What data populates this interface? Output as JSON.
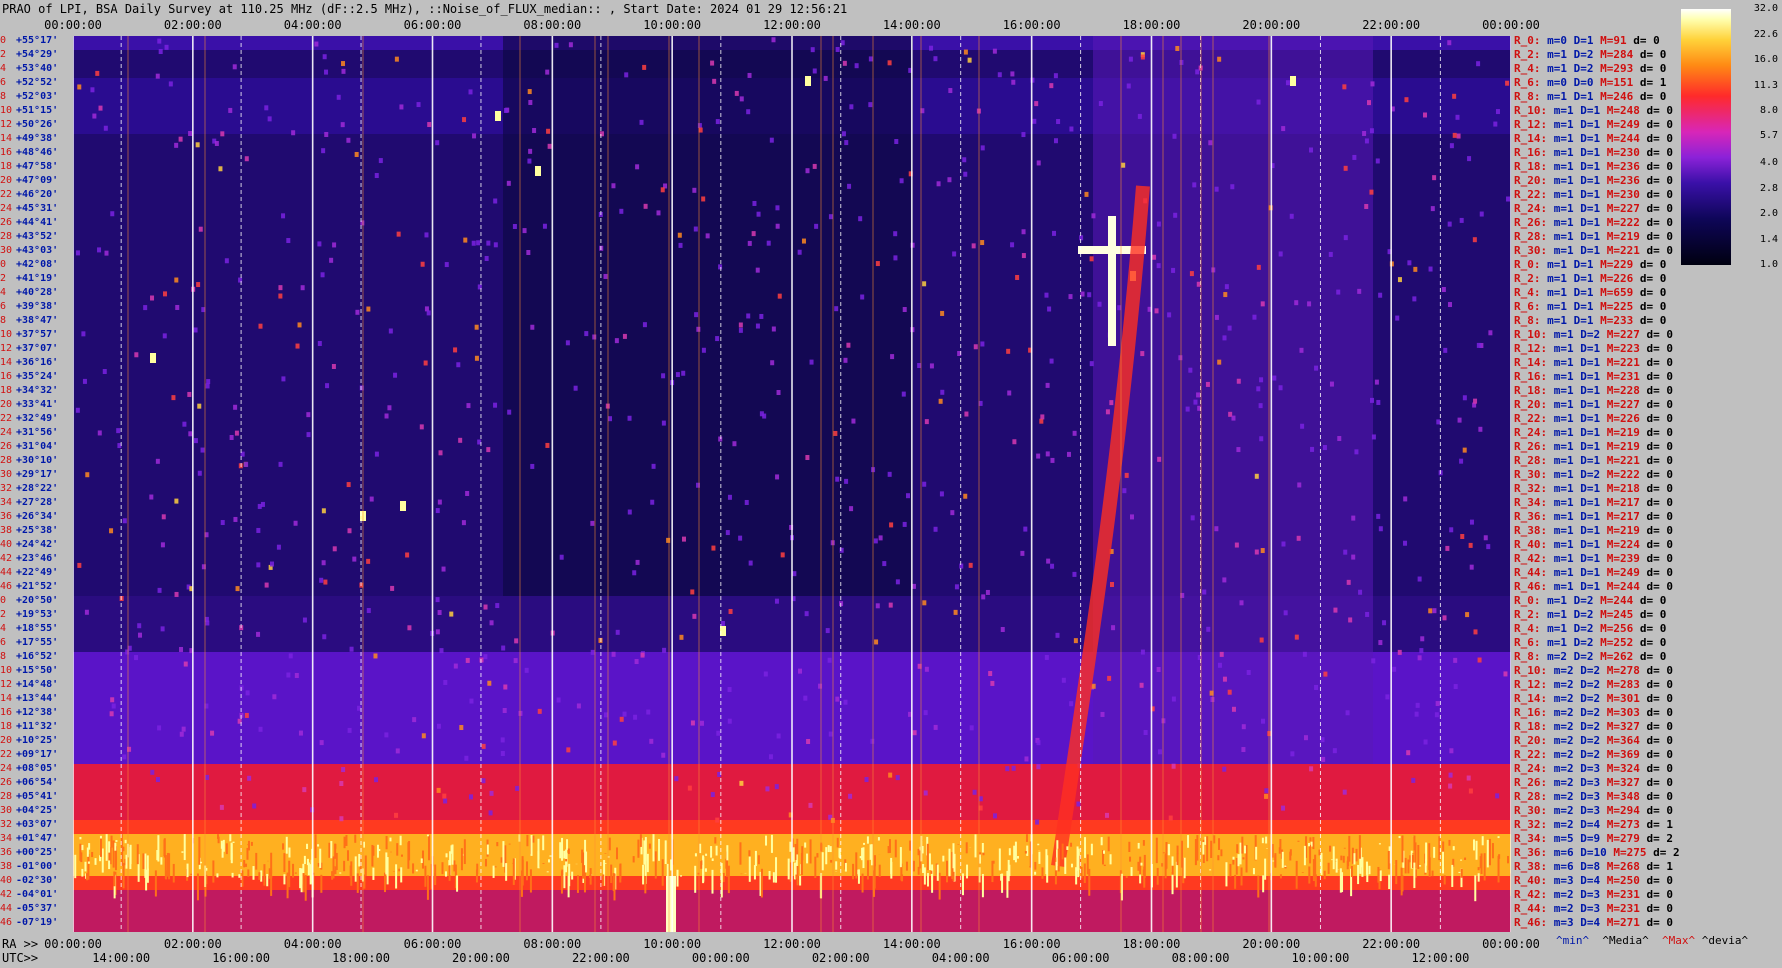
{
  "title": "PRAO of LPI, BSA Daily Survey at 110.25 MHz (dF::2.5 MHz), ::Noise_of_FLUX_median:: , Start Date: 2024 01 29 12:56:21",
  "chart_data": {
    "type": "heatmap",
    "title": "PRAO of LPI, BSA Daily Survey at 110.25 MHz (dF::2.5 MHz), ::Noise_of_FLUX_median:: , Start Date: 2024 01 29 12:56:21",
    "x_top_ticks": [
      "00:00:00",
      "02:00:00",
      "04:00:00",
      "06:00:00",
      "08:00:00",
      "10:00:00",
      "12:00:00",
      "14:00:00",
      "16:00:00",
      "18:00:00",
      "20:00:00",
      "22:00:00",
      "00:00:00"
    ],
    "ra_prefix": "RA >>",
    "ra_ticks": [
      "00:00:00",
      "02:00:00",
      "04:00:00",
      "06:00:00",
      "08:00:00",
      "10:00:00",
      "12:00:00",
      "14:00:00",
      "16:00:00",
      "18:00:00",
      "20:00:00",
      "22:00:00",
      "00:00:00"
    ],
    "utc_prefix": "UTC>>",
    "utc_ticks": [
      "14:00:00",
      "16:00:00",
      "18:00:00",
      "20:00:00",
      "22:00:00",
      "00:00:00",
      "02:00:00",
      "04:00:00",
      "06:00:00",
      "08:00:00",
      "10:00:00",
      "12:00:00"
    ],
    "dec_labels": [
      "+55°17'",
      "+54°29'",
      "+53°40'",
      "+52°52'",
      "+52°03'",
      "+51°15'",
      "+50°26'",
      "+49°38'",
      "+48°46'",
      "+47°58'",
      "+47°09'",
      "+46°20'",
      "+45°31'",
      "+44°41'",
      "+43°52'",
      "+43°03'",
      "+42°08'",
      "+41°19'",
      "+40°28'",
      "+39°38'",
      "+38°47'",
      "+37°57'",
      "+37°07'",
      "+36°16'",
      "+35°24'",
      "+34°32'",
      "+33°41'",
      "+32°49'",
      "+31°56'",
      "+31°04'",
      "+30°10'",
      "+29°17'",
      "+28°22'",
      "+27°28'",
      "+26°34'",
      "+25°38'",
      "+24°42'",
      "+23°46'",
      "+22°49'",
      "+21°52'",
      "+20°50'",
      "+19°53'",
      "+18°55'",
      "+17°55'",
      "+16°52'",
      "+15°50'",
      "+14°48'",
      "+13°44'",
      "+12°38'",
      "+11°32'",
      "+10°25'",
      "+09°17'",
      "+08°05'",
      "+06°54'",
      "+05°41'",
      "+04°25'",
      "+03°07'",
      "+01°47'",
      "+00°25'",
      "-01°00'",
      "-02°30'",
      "-04°01'",
      "-05°37'",
      "-07°19'"
    ],
    "dec_index": [
      "0",
      "2",
      "4",
      "6",
      "8",
      "10",
      "12",
      "14",
      "16",
      "18",
      "20",
      "22",
      "24",
      "26",
      "28",
      "30",
      "0",
      "2",
      "4",
      "6",
      "8",
      "10",
      "12",
      "14",
      "16",
      "18",
      "20",
      "22",
      "24",
      "26",
      "28",
      "30",
      "32",
      "34",
      "36",
      "38",
      "40",
      "42",
      "44",
      "46",
      "0",
      "2",
      "4",
      "6",
      "8",
      "10",
      "12",
      "14",
      "16",
      "18",
      "20",
      "22",
      "24",
      "26",
      "28",
      "30",
      "32",
      "34",
      "36",
      "38",
      "40",
      "42",
      "44",
      "46"
    ],
    "row_stats": [
      {
        "r": "R_0:",
        "m": "0",
        "d": "1",
        "M": "91",
        "dev": "0"
      },
      {
        "r": "R_2:",
        "m": "1",
        "d": "2",
        "M": "284",
        "dev": "0"
      },
      {
        "r": "R_4:",
        "m": "1",
        "d": "2",
        "M": "293",
        "dev": "0"
      },
      {
        "r": "R_6:",
        "m": "0",
        "d": "0",
        "M": "151",
        "dev": "1"
      },
      {
        "r": "R_8:",
        "m": "1",
        "d": "1",
        "M": "246",
        "dev": "0"
      },
      {
        "r": "R_10:",
        "m": "1",
        "d": "1",
        "M": "248",
        "dev": "0"
      },
      {
        "r": "R_12:",
        "m": "1",
        "d": "1",
        "M": "249",
        "dev": "0"
      },
      {
        "r": "R_14:",
        "m": "1",
        "d": "1",
        "M": "244",
        "dev": "0"
      },
      {
        "r": "R_16:",
        "m": "1",
        "d": "1",
        "M": "230",
        "dev": "0"
      },
      {
        "r": "R_18:",
        "m": "1",
        "d": "1",
        "M": "236",
        "dev": "0"
      },
      {
        "r": "R_20:",
        "m": "1",
        "d": "1",
        "M": "236",
        "dev": "0"
      },
      {
        "r": "R_22:",
        "m": "1",
        "d": "1",
        "M": "230",
        "dev": "0"
      },
      {
        "r": "R_24:",
        "m": "1",
        "d": "1",
        "M": "227",
        "dev": "0"
      },
      {
        "r": "R_26:",
        "m": "1",
        "d": "1",
        "M": "222",
        "dev": "0"
      },
      {
        "r": "R_28:",
        "m": "1",
        "d": "1",
        "M": "219",
        "dev": "0"
      },
      {
        "r": "R_30:",
        "m": "1",
        "d": "1",
        "M": "221",
        "dev": "0"
      },
      {
        "r": "R_0:",
        "m": "1",
        "d": "1",
        "M": "229",
        "dev": "0"
      },
      {
        "r": "R_2:",
        "m": "1",
        "d": "1",
        "M": "226",
        "dev": "0"
      },
      {
        "r": "R_4:",
        "m": "1",
        "d": "1",
        "M": "659",
        "dev": "0"
      },
      {
        "r": "R_6:",
        "m": "1",
        "d": "1",
        "M": "225",
        "dev": "0"
      },
      {
        "r": "R_8:",
        "m": "1",
        "d": "1",
        "M": "233",
        "dev": "0"
      },
      {
        "r": "R_10:",
        "m": "1",
        "d": "2",
        "M": "227",
        "dev": "0"
      },
      {
        "r": "R_12:",
        "m": "1",
        "d": "1",
        "M": "223",
        "dev": "0"
      },
      {
        "r": "R_14:",
        "m": "1",
        "d": "1",
        "M": "221",
        "dev": "0"
      },
      {
        "r": "R_16:",
        "m": "1",
        "d": "1",
        "M": "231",
        "dev": "0"
      },
      {
        "r": "R_18:",
        "m": "1",
        "d": "1",
        "M": "228",
        "dev": "0"
      },
      {
        "r": "R_20:",
        "m": "1",
        "d": "1",
        "M": "227",
        "dev": "0"
      },
      {
        "r": "R_22:",
        "m": "1",
        "d": "1",
        "M": "226",
        "dev": "0"
      },
      {
        "r": "R_24:",
        "m": "1",
        "d": "1",
        "M": "219",
        "dev": "0"
      },
      {
        "r": "R_26:",
        "m": "1",
        "d": "1",
        "M": "219",
        "dev": "0"
      },
      {
        "r": "R_28:",
        "m": "1",
        "d": "1",
        "M": "221",
        "dev": "0"
      },
      {
        "r": "R_30:",
        "m": "1",
        "d": "2",
        "M": "222",
        "dev": "0"
      },
      {
        "r": "R_32:",
        "m": "1",
        "d": "1",
        "M": "218",
        "dev": "0"
      },
      {
        "r": "R_34:",
        "m": "1",
        "d": "1",
        "M": "217",
        "dev": "0"
      },
      {
        "r": "R_36:",
        "m": "1",
        "d": "1",
        "M": "217",
        "dev": "0"
      },
      {
        "r": "R_38:",
        "m": "1",
        "d": "1",
        "M": "219",
        "dev": "0"
      },
      {
        "r": "R_40:",
        "m": "1",
        "d": "1",
        "M": "224",
        "dev": "0"
      },
      {
        "r": "R_42:",
        "m": "1",
        "d": "1",
        "M": "239",
        "dev": "0"
      },
      {
        "r": "R_44:",
        "m": "1",
        "d": "1",
        "M": "249",
        "dev": "0"
      },
      {
        "r": "R_46:",
        "m": "1",
        "d": "1",
        "M": "244",
        "dev": "0"
      },
      {
        "r": "R_0:",
        "m": "1",
        "d": "2",
        "M": "244",
        "dev": "0"
      },
      {
        "r": "R_2:",
        "m": "1",
        "d": "2",
        "M": "245",
        "dev": "0"
      },
      {
        "r": "R_4:",
        "m": "1",
        "d": "2",
        "M": "256",
        "dev": "0"
      },
      {
        "r": "R_6:",
        "m": "1",
        "d": "2",
        "M": "252",
        "dev": "0"
      },
      {
        "r": "R_8:",
        "m": "2",
        "d": "2",
        "M": "262",
        "dev": "0"
      },
      {
        "r": "R_10:",
        "m": "2",
        "d": "2",
        "M": "278",
        "dev": "0"
      },
      {
        "r": "R_12:",
        "m": "2",
        "d": "2",
        "M": "283",
        "dev": "0"
      },
      {
        "r": "R_14:",
        "m": "2",
        "d": "2",
        "M": "301",
        "dev": "0"
      },
      {
        "r": "R_16:",
        "m": "2",
        "d": "2",
        "M": "303",
        "dev": "0"
      },
      {
        "r": "R_18:",
        "m": "2",
        "d": "2",
        "M": "327",
        "dev": "0"
      },
      {
        "r": "R_20:",
        "m": "2",
        "d": "2",
        "M": "364",
        "dev": "0"
      },
      {
        "r": "R_22:",
        "m": "2",
        "d": "2",
        "M": "369",
        "dev": "0"
      },
      {
        "r": "R_24:",
        "m": "2",
        "d": "3",
        "M": "324",
        "dev": "0"
      },
      {
        "r": "R_26:",
        "m": "2",
        "d": "3",
        "M": "327",
        "dev": "0"
      },
      {
        "r": "R_28:",
        "m": "2",
        "d": "3",
        "M": "348",
        "dev": "0"
      },
      {
        "r": "R_30:",
        "m": "2",
        "d": "3",
        "M": "294",
        "dev": "0"
      },
      {
        "r": "R_32:",
        "m": "2",
        "d": "4",
        "M": "273",
        "dev": "1"
      },
      {
        "r": "R_34:",
        "m": "5",
        "d": "9",
        "M": "279",
        "dev": "2"
      },
      {
        "r": "R_36:",
        "m": "6",
        "d": "10",
        "M": "275",
        "dev": "2"
      },
      {
        "r": "R_38:",
        "m": "6",
        "d": "8",
        "M": "268",
        "dev": "1"
      },
      {
        "r": "R_40:",
        "m": "3",
        "d": "4",
        "M": "250",
        "dev": "0"
      },
      {
        "r": "R_42:",
        "m": "2",
        "d": "3",
        "M": "231",
        "dev": "0"
      },
      {
        "r": "R_44:",
        "m": "2",
        "d": "3",
        "M": "231",
        "dev": "0"
      },
      {
        "r": "R_46:",
        "m": "3",
        "d": "4",
        "M": "271",
        "dev": "0"
      }
    ],
    "stat_legend": {
      "min": "^min^",
      "median": "^Media^",
      "max": "^Max^",
      "devia": "^devia^"
    },
    "colorbar": {
      "ticks": [
        "32.0",
        "22.6",
        "16.0",
        "11.3",
        "8.0",
        "5.7",
        "4.0",
        "2.8",
        "2.0",
        "1.4",
        "1.0"
      ],
      "range": [
        1.0,
        32.0
      ],
      "scale": "log"
    },
    "colors": {
      "low": "#0a0530",
      "mid": "#7a1ee0",
      "high": "#ff2020",
      "peak": "#ffffc0",
      "label_red": "#d01010",
      "label_blue": "#0018a8"
    }
  }
}
